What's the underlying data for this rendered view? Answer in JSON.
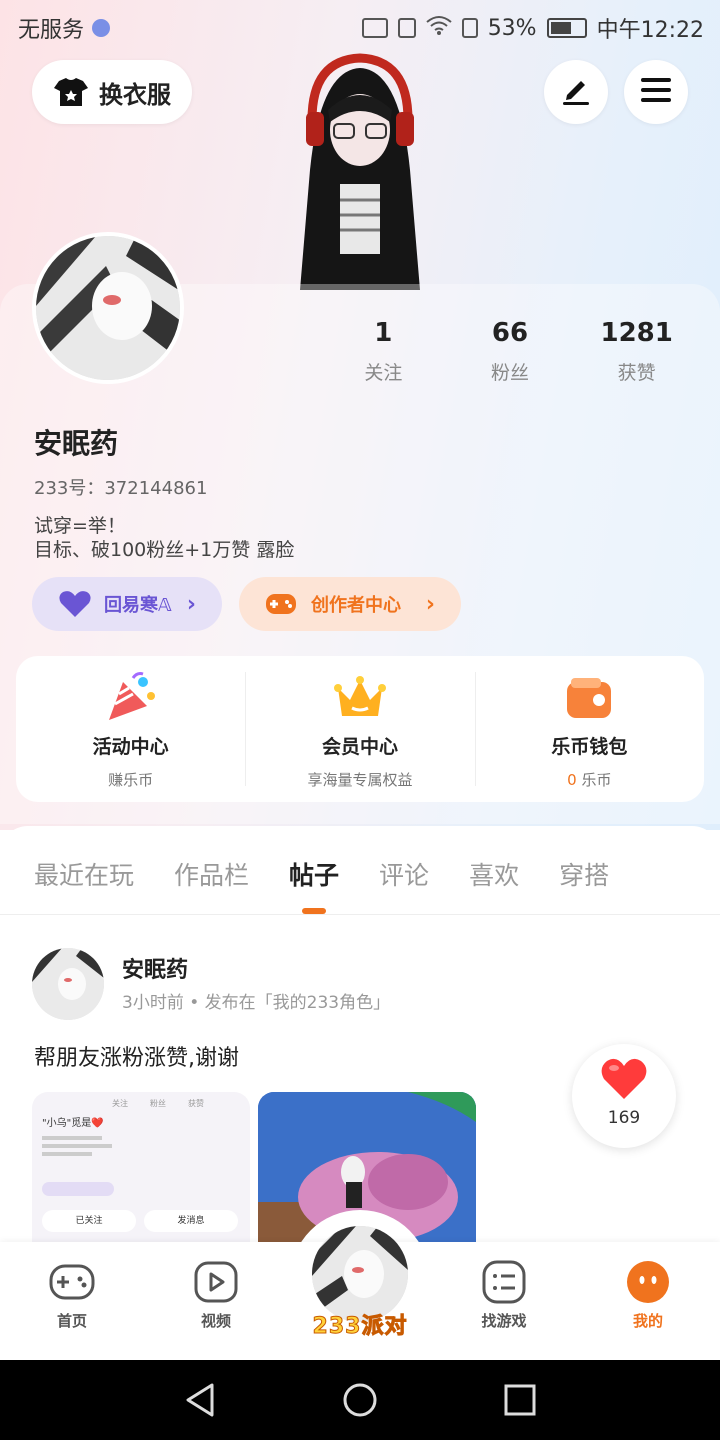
{
  "status_bar": {
    "left_text": "无服务",
    "battery": "53%",
    "time": "中午12:22"
  },
  "header": {
    "outfit_button": "换衣服"
  },
  "profile": {
    "stats": [
      {
        "value": "1",
        "label": "关注"
      },
      {
        "value": "66",
        "label": "粉丝"
      },
      {
        "value": "1281",
        "label": "获赞"
      }
    ],
    "name": "安眠药",
    "uid": "233号：372144861",
    "bio": "试穿=举！\n目标、破100粉丝+1万赞 露脸",
    "vip_pill": "回易寒𝔸",
    "creator_pill": "创作者中心"
  },
  "features": [
    {
      "title": "活动中心",
      "sub": "赚乐币",
      "icon": "party-popper-icon"
    },
    {
      "title": "会员中心",
      "sub": "享海量专属权益",
      "icon": "crown-icon"
    },
    {
      "title": "乐币钱包",
      "sub_value": "0",
      "sub_unit": "乐币",
      "icon": "wallet-icon"
    }
  ],
  "tabs": [
    "最近在玩",
    "作品栏",
    "帖子",
    "评论",
    "喜欢",
    "穿搭"
  ],
  "active_tab": "帖子",
  "post": {
    "author": "安眠药",
    "meta": "3小时前 • 发布在「我的233角色」",
    "text": "帮朋友涨粉涨赞,谢谢",
    "likes": "169",
    "thumb1": {
      "stats": [
        "关注",
        "粉丝",
        "获赞"
      ],
      "name": "\"小乌\"觅是❤️",
      "followed": "已关注",
      "message": "发消息"
    }
  },
  "bottom_nav": [
    {
      "label": "首页",
      "icon": "gamepad-icon"
    },
    {
      "label": "视频",
      "icon": "play-icon"
    },
    {
      "label": "233派对",
      "icon": "party-avatar"
    },
    {
      "label": "找游戏",
      "icon": "list-icon"
    },
    {
      "label": "我的",
      "icon": "me-icon"
    }
  ],
  "colors": {
    "accent": "#f0731e",
    "vip": "#6a55d4",
    "heart": "#ff3b3b"
  }
}
